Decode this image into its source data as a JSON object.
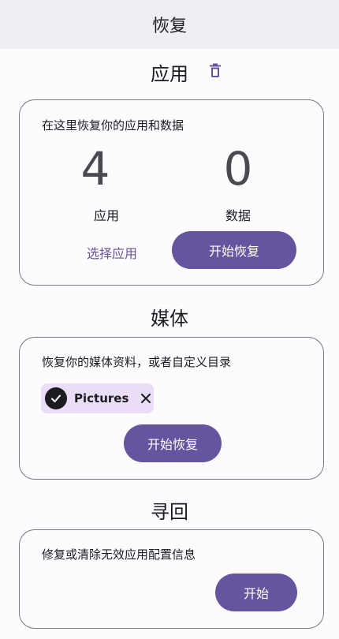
{
  "header": {
    "title": "恢复"
  },
  "apps_section": {
    "title": "应用",
    "trash_icon": "trash-icon",
    "description": "在这里恢复你的应用和数据",
    "apps_count": "4",
    "apps_label": "应用",
    "data_count": "0",
    "data_label": "数据",
    "select_button": "选择应用",
    "restore_button": "开始恢复"
  },
  "media_section": {
    "title": "媒体",
    "description": "恢复你的媒体资料，或者自定义目录",
    "chip_label": "Pictures",
    "chip_icon": "check-icon",
    "chip_close_icon": "close-icon",
    "restore_button": "开始恢复"
  },
  "retrieve_section": {
    "title": "寻回",
    "description": "修复或清除无效应用配置信息",
    "start_button": "开始"
  },
  "colors": {
    "accent": "#65559e",
    "chip_bg": "#e9ddf7",
    "header_bg": "#f1edf4"
  }
}
